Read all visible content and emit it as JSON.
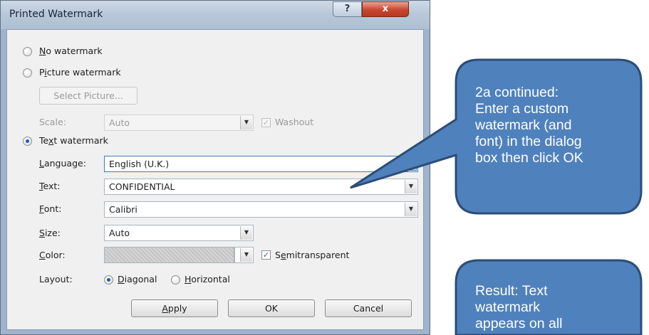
{
  "dialog": {
    "title": "Printed Watermark",
    "help_label": "?",
    "close_label": "x",
    "no_watermark": {
      "pre": "",
      "key": "N",
      "post": "o watermark"
    },
    "picture_watermark": {
      "pre": "P",
      "key": "i",
      "post": "cture watermark"
    },
    "select_picture": "Select Picture...",
    "scale_label": "Scale:",
    "scale_value": "Auto",
    "washout_label": "Washout",
    "text_watermark": {
      "pre": "Te",
      "key": "x",
      "post": "t watermark"
    },
    "language": {
      "key": "L",
      "post": "anguage:",
      "value": "English (U.K.)"
    },
    "text": {
      "key": "T",
      "post": "ext:",
      "value": "CONFIDENTIAL"
    },
    "font": {
      "key": "F",
      "post": "ont:",
      "value": "Calibri"
    },
    "size": {
      "key": "S",
      "post": "ize:",
      "value": "Auto"
    },
    "color": {
      "key": "C",
      "post": "olor:"
    },
    "semitransparent": {
      "pre": "S",
      "key": "e",
      "post": "mitransparent"
    },
    "layout_label": "Layout:",
    "diagonal": {
      "key": "D",
      "post": "iagonal"
    },
    "horizontal": {
      "key": "H",
      "post": "orizontal"
    },
    "apply": {
      "key": "A",
      "post": "pply"
    },
    "ok": "OK",
    "cancel": "Cancel",
    "check_mark": "✓",
    "dropdown_arrow": "▼"
  },
  "callout1": {
    "lines": [
      "2a continued:",
      "Enter a custom",
      "watermark (and",
      "font) in the dialog",
      "box then click OK"
    ]
  },
  "callout2": {
    "lines": [
      "Result: Text",
      "watermark",
      "appears on all"
    ]
  },
  "colors": {
    "callout_fill": "#4f81bd",
    "callout_stroke": "#2c4d75",
    "title_bar": "#b9c8d9",
    "close_button": "#c8452d",
    "radio_selected": "#1c5bb5"
  },
  "icons": {
    "help": "question-icon",
    "close": "close-icon",
    "dropdown": "chevron-down-icon",
    "check": "checkmark-icon"
  }
}
